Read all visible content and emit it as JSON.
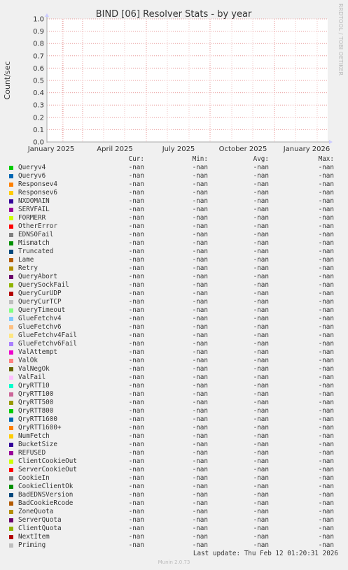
{
  "title": "BIND [06] Resolver Stats - by year",
  "side_label": "RRDTOOL / TOBI OETIKER",
  "footer": {
    "last_update": "Last update: Thu Feb 12 01:20:31 2026",
    "version": "Munin 2.0.73"
  },
  "chart_data": {
    "type": "line",
    "title": "BIND [06] Resolver Stats - by year",
    "ylabel": "Count/sec",
    "xlabel": "",
    "ylim": [
      0,
      1.0
    ],
    "y_ticks": [
      "0.0",
      "0.1",
      "0.2",
      "0.3",
      "0.4",
      "0.5",
      "0.6",
      "0.7",
      "0.8",
      "0.9",
      "1.0"
    ],
    "x_ticks": [
      "January 2025",
      "April 2025",
      "July 2025",
      "October 2025",
      "January 2026"
    ],
    "grid": true,
    "columns": [
      "Cur:",
      "Min:",
      "Avg:",
      "Max:"
    ],
    "series": [
      {
        "name": "Queryv4",
        "color": "#00cc00",
        "values": [
          "-nan",
          "-nan",
          "-nan",
          "-nan"
        ]
      },
      {
        "name": "Queryv6",
        "color": "#0066b3",
        "values": [
          "-nan",
          "-nan",
          "-nan",
          "-nan"
        ]
      },
      {
        "name": "Responsev4",
        "color": "#ff8000",
        "values": [
          "-nan",
          "-nan",
          "-nan",
          "-nan"
        ]
      },
      {
        "name": "Responsev6",
        "color": "#ffcc00",
        "values": [
          "-nan",
          "-nan",
          "-nan",
          "-nan"
        ]
      },
      {
        "name": "NXDOMAIN",
        "color": "#330099",
        "values": [
          "-nan",
          "-nan",
          "-nan",
          "-nan"
        ]
      },
      {
        "name": "SERVFAIL",
        "color": "#990099",
        "values": [
          "-nan",
          "-nan",
          "-nan",
          "-nan"
        ]
      },
      {
        "name": "FORMERR",
        "color": "#ccff00",
        "values": [
          "-nan",
          "-nan",
          "-nan",
          "-nan"
        ]
      },
      {
        "name": "OtherError",
        "color": "#ff0000",
        "values": [
          "-nan",
          "-nan",
          "-nan",
          "-nan"
        ]
      },
      {
        "name": "EDNS0Fail",
        "color": "#808080",
        "values": [
          "-nan",
          "-nan",
          "-nan",
          "-nan"
        ]
      },
      {
        "name": "Mismatch",
        "color": "#008f00",
        "values": [
          "-nan",
          "-nan",
          "-nan",
          "-nan"
        ]
      },
      {
        "name": "Truncated",
        "color": "#00487d",
        "values": [
          "-nan",
          "-nan",
          "-nan",
          "-nan"
        ]
      },
      {
        "name": "Lame",
        "color": "#b35a00",
        "values": [
          "-nan",
          "-nan",
          "-nan",
          "-nan"
        ]
      },
      {
        "name": "Retry",
        "color": "#b38f00",
        "values": [
          "-nan",
          "-nan",
          "-nan",
          "-nan"
        ]
      },
      {
        "name": "QueryAbort",
        "color": "#6b006b",
        "values": [
          "-nan",
          "-nan",
          "-nan",
          "-nan"
        ]
      },
      {
        "name": "QuerySockFail",
        "color": "#8fb300",
        "values": [
          "-nan",
          "-nan",
          "-nan",
          "-nan"
        ]
      },
      {
        "name": "QueryCurUDP",
        "color": "#b30000",
        "values": [
          "-nan",
          "-nan",
          "-nan",
          "-nan"
        ]
      },
      {
        "name": "QueryCurTCP",
        "color": "#bebebe",
        "values": [
          "-nan",
          "-nan",
          "-nan",
          "-nan"
        ]
      },
      {
        "name": "QueryTimeout",
        "color": "#80ff80",
        "values": [
          "-nan",
          "-nan",
          "-nan",
          "-nan"
        ]
      },
      {
        "name": "GlueFetchv4",
        "color": "#80c9ff",
        "values": [
          "-nan",
          "-nan",
          "-nan",
          "-nan"
        ]
      },
      {
        "name": "GlueFetchv6",
        "color": "#ffc080",
        "values": [
          "-nan",
          "-nan",
          "-nan",
          "-nan"
        ]
      },
      {
        "name": "GlueFetchv4Fail",
        "color": "#ffe680",
        "values": [
          "-nan",
          "-nan",
          "-nan",
          "-nan"
        ]
      },
      {
        "name": "GlueFetchv6Fail",
        "color": "#aa80ff",
        "values": [
          "-nan",
          "-nan",
          "-nan",
          "-nan"
        ]
      },
      {
        "name": "ValAttempt",
        "color": "#ee00cc",
        "values": [
          "-nan",
          "-nan",
          "-nan",
          "-nan"
        ]
      },
      {
        "name": "ValOk",
        "color": "#ff8080",
        "values": [
          "-nan",
          "-nan",
          "-nan",
          "-nan"
        ]
      },
      {
        "name": "ValNegOk",
        "color": "#666600",
        "values": [
          "-nan",
          "-nan",
          "-nan",
          "-nan"
        ]
      },
      {
        "name": "ValFail",
        "color": "#ffbfff",
        "values": [
          "-nan",
          "-nan",
          "-nan",
          "-nan"
        ]
      },
      {
        "name": "QryRTT10",
        "color": "#00ffcc",
        "values": [
          "-nan",
          "-nan",
          "-nan",
          "-nan"
        ]
      },
      {
        "name": "QryRTT100",
        "color": "#cc6699",
        "values": [
          "-nan",
          "-nan",
          "-nan",
          "-nan"
        ]
      },
      {
        "name": "QryRTT500",
        "color": "#999900",
        "values": [
          "-nan",
          "-nan",
          "-nan",
          "-nan"
        ]
      },
      {
        "name": "QryRTT800",
        "color": "#00cc00",
        "values": [
          "-nan",
          "-nan",
          "-nan",
          "-nan"
        ]
      },
      {
        "name": "QryRTT1600",
        "color": "#0066b3",
        "values": [
          "-nan",
          "-nan",
          "-nan",
          "-nan"
        ]
      },
      {
        "name": "QryRTT1600+",
        "color": "#ff8000",
        "values": [
          "-nan",
          "-nan",
          "-nan",
          "-nan"
        ]
      },
      {
        "name": "NumFetch",
        "color": "#ffcc00",
        "values": [
          "-nan",
          "-nan",
          "-nan",
          "-nan"
        ]
      },
      {
        "name": "BucketSize",
        "color": "#330099",
        "values": [
          "-nan",
          "-nan",
          "-nan",
          "-nan"
        ]
      },
      {
        "name": "REFUSED",
        "color": "#990099",
        "values": [
          "-nan",
          "-nan",
          "-nan",
          "-nan"
        ]
      },
      {
        "name": "ClientCookieOut",
        "color": "#ccff00",
        "values": [
          "-nan",
          "-nan",
          "-nan",
          "-nan"
        ]
      },
      {
        "name": "ServerCookieOut",
        "color": "#ff0000",
        "values": [
          "-nan",
          "-nan",
          "-nan",
          "-nan"
        ]
      },
      {
        "name": "CookieIn",
        "color": "#808080",
        "values": [
          "-nan",
          "-nan",
          "-nan",
          "-nan"
        ]
      },
      {
        "name": "CookieClientOk",
        "color": "#008f00",
        "values": [
          "-nan",
          "-nan",
          "-nan",
          "-nan"
        ]
      },
      {
        "name": "BadEDNSVersion",
        "color": "#00487d",
        "values": [
          "-nan",
          "-nan",
          "-nan",
          "-nan"
        ]
      },
      {
        "name": "BadCookieRcode",
        "color": "#b35a00",
        "values": [
          "-nan",
          "-nan",
          "-nan",
          "-nan"
        ]
      },
      {
        "name": "ZoneQuota",
        "color": "#b38f00",
        "values": [
          "-nan",
          "-nan",
          "-nan",
          "-nan"
        ]
      },
      {
        "name": "ServerQuota",
        "color": "#6b006b",
        "values": [
          "-nan",
          "-nan",
          "-nan",
          "-nan"
        ]
      },
      {
        "name": "ClientQuota",
        "color": "#8fb300",
        "values": [
          "-nan",
          "-nan",
          "-nan",
          "-nan"
        ]
      },
      {
        "name": "NextItem",
        "color": "#b30000",
        "values": [
          "-nan",
          "-nan",
          "-nan",
          "-nan"
        ]
      },
      {
        "name": "Priming",
        "color": "#bebebe",
        "values": [
          "-nan",
          "-nan",
          "-nan",
          "-nan"
        ]
      }
    ]
  }
}
